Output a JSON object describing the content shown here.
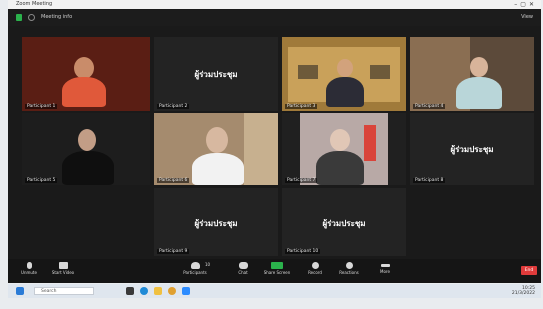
{
  "window": {
    "title": "Zoom Meeting"
  },
  "topbar": {
    "meeting_label": "Meeting info",
    "view_label": "View"
  },
  "tiles": [
    {
      "name": "Participant 1",
      "text": ""
    },
    {
      "name": "Participant 2",
      "text": "ผู้ร่วมประชุม"
    },
    {
      "name": "Participant 3",
      "text": ""
    },
    {
      "name": "Participant 4",
      "text": ""
    },
    {
      "name": "Participant 5",
      "text": ""
    },
    {
      "name": "Participant 6",
      "text": ""
    },
    {
      "name": "Participant 7",
      "text": ""
    },
    {
      "name": "Participant 8",
      "text": "ผู้ร่วมประชุม"
    },
    {
      "name": "Participant 9",
      "text": "ผู้ร่วมประชุม"
    },
    {
      "name": "Participant 10",
      "text": "ผู้ร่วมประชุม"
    }
  ],
  "toolbar": {
    "mute": "Unmute",
    "video": "Start Video",
    "participants": "Participants",
    "participants_count": "10",
    "chat": "Chat",
    "share": "Share Screen",
    "record": "Record",
    "reactions": "Reactions",
    "more": "More",
    "end": "End"
  },
  "taskbar": {
    "search_placeholder": "Search",
    "time": "10:25",
    "date": "21/3/2022"
  },
  "colors": {
    "active_speaker": "#e6c84a",
    "share_green": "#2bb24c",
    "end_red": "#e03b3b"
  }
}
